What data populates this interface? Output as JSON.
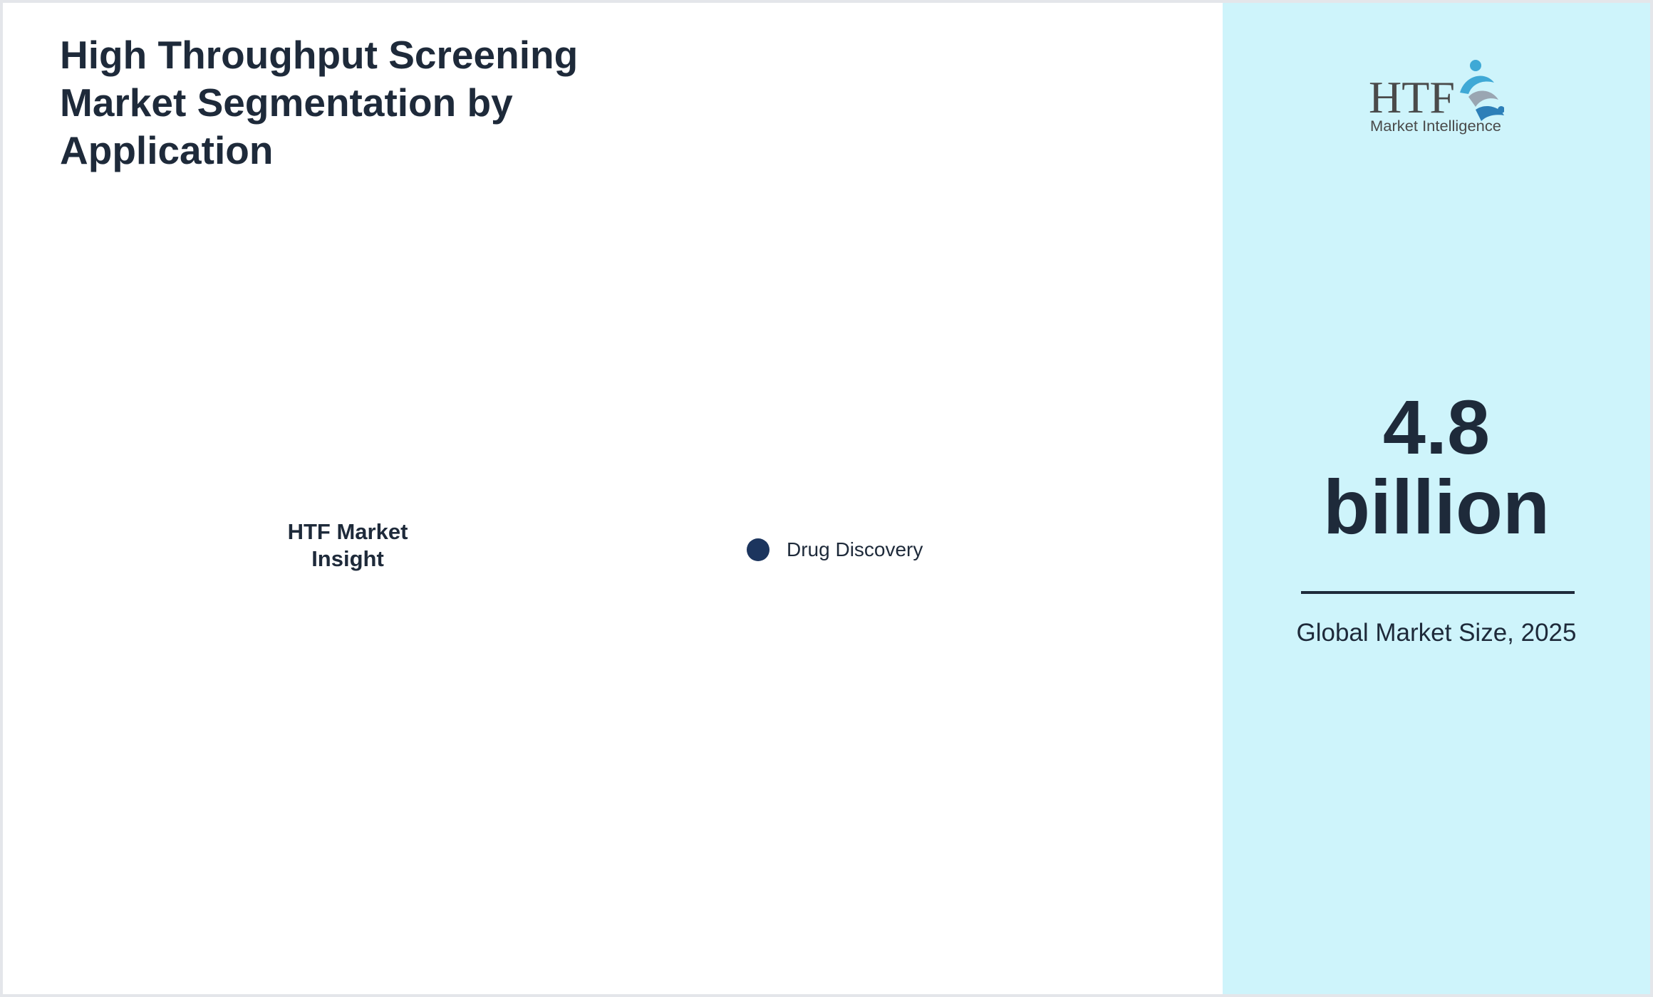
{
  "title": "High Throughput Screening Market Segmentation by Application",
  "center_label": "HTF Market Insight",
  "chart_data": {
    "type": "pie",
    "title": "High Throughput Screening Market Segmentation by Application",
    "legend_position": "right",
    "series": [
      {
        "name": "Drug Discovery",
        "color": "#1c355e"
      }
    ]
  },
  "side_panel": {
    "logo": {
      "icon": "htf-logo",
      "brand": "HTF",
      "tagline": "Market Intelligence"
    },
    "value_number": "4.8",
    "value_unit": "billion",
    "caption": "Global Market Size, 2025",
    "background_color": "#cef4fb"
  }
}
